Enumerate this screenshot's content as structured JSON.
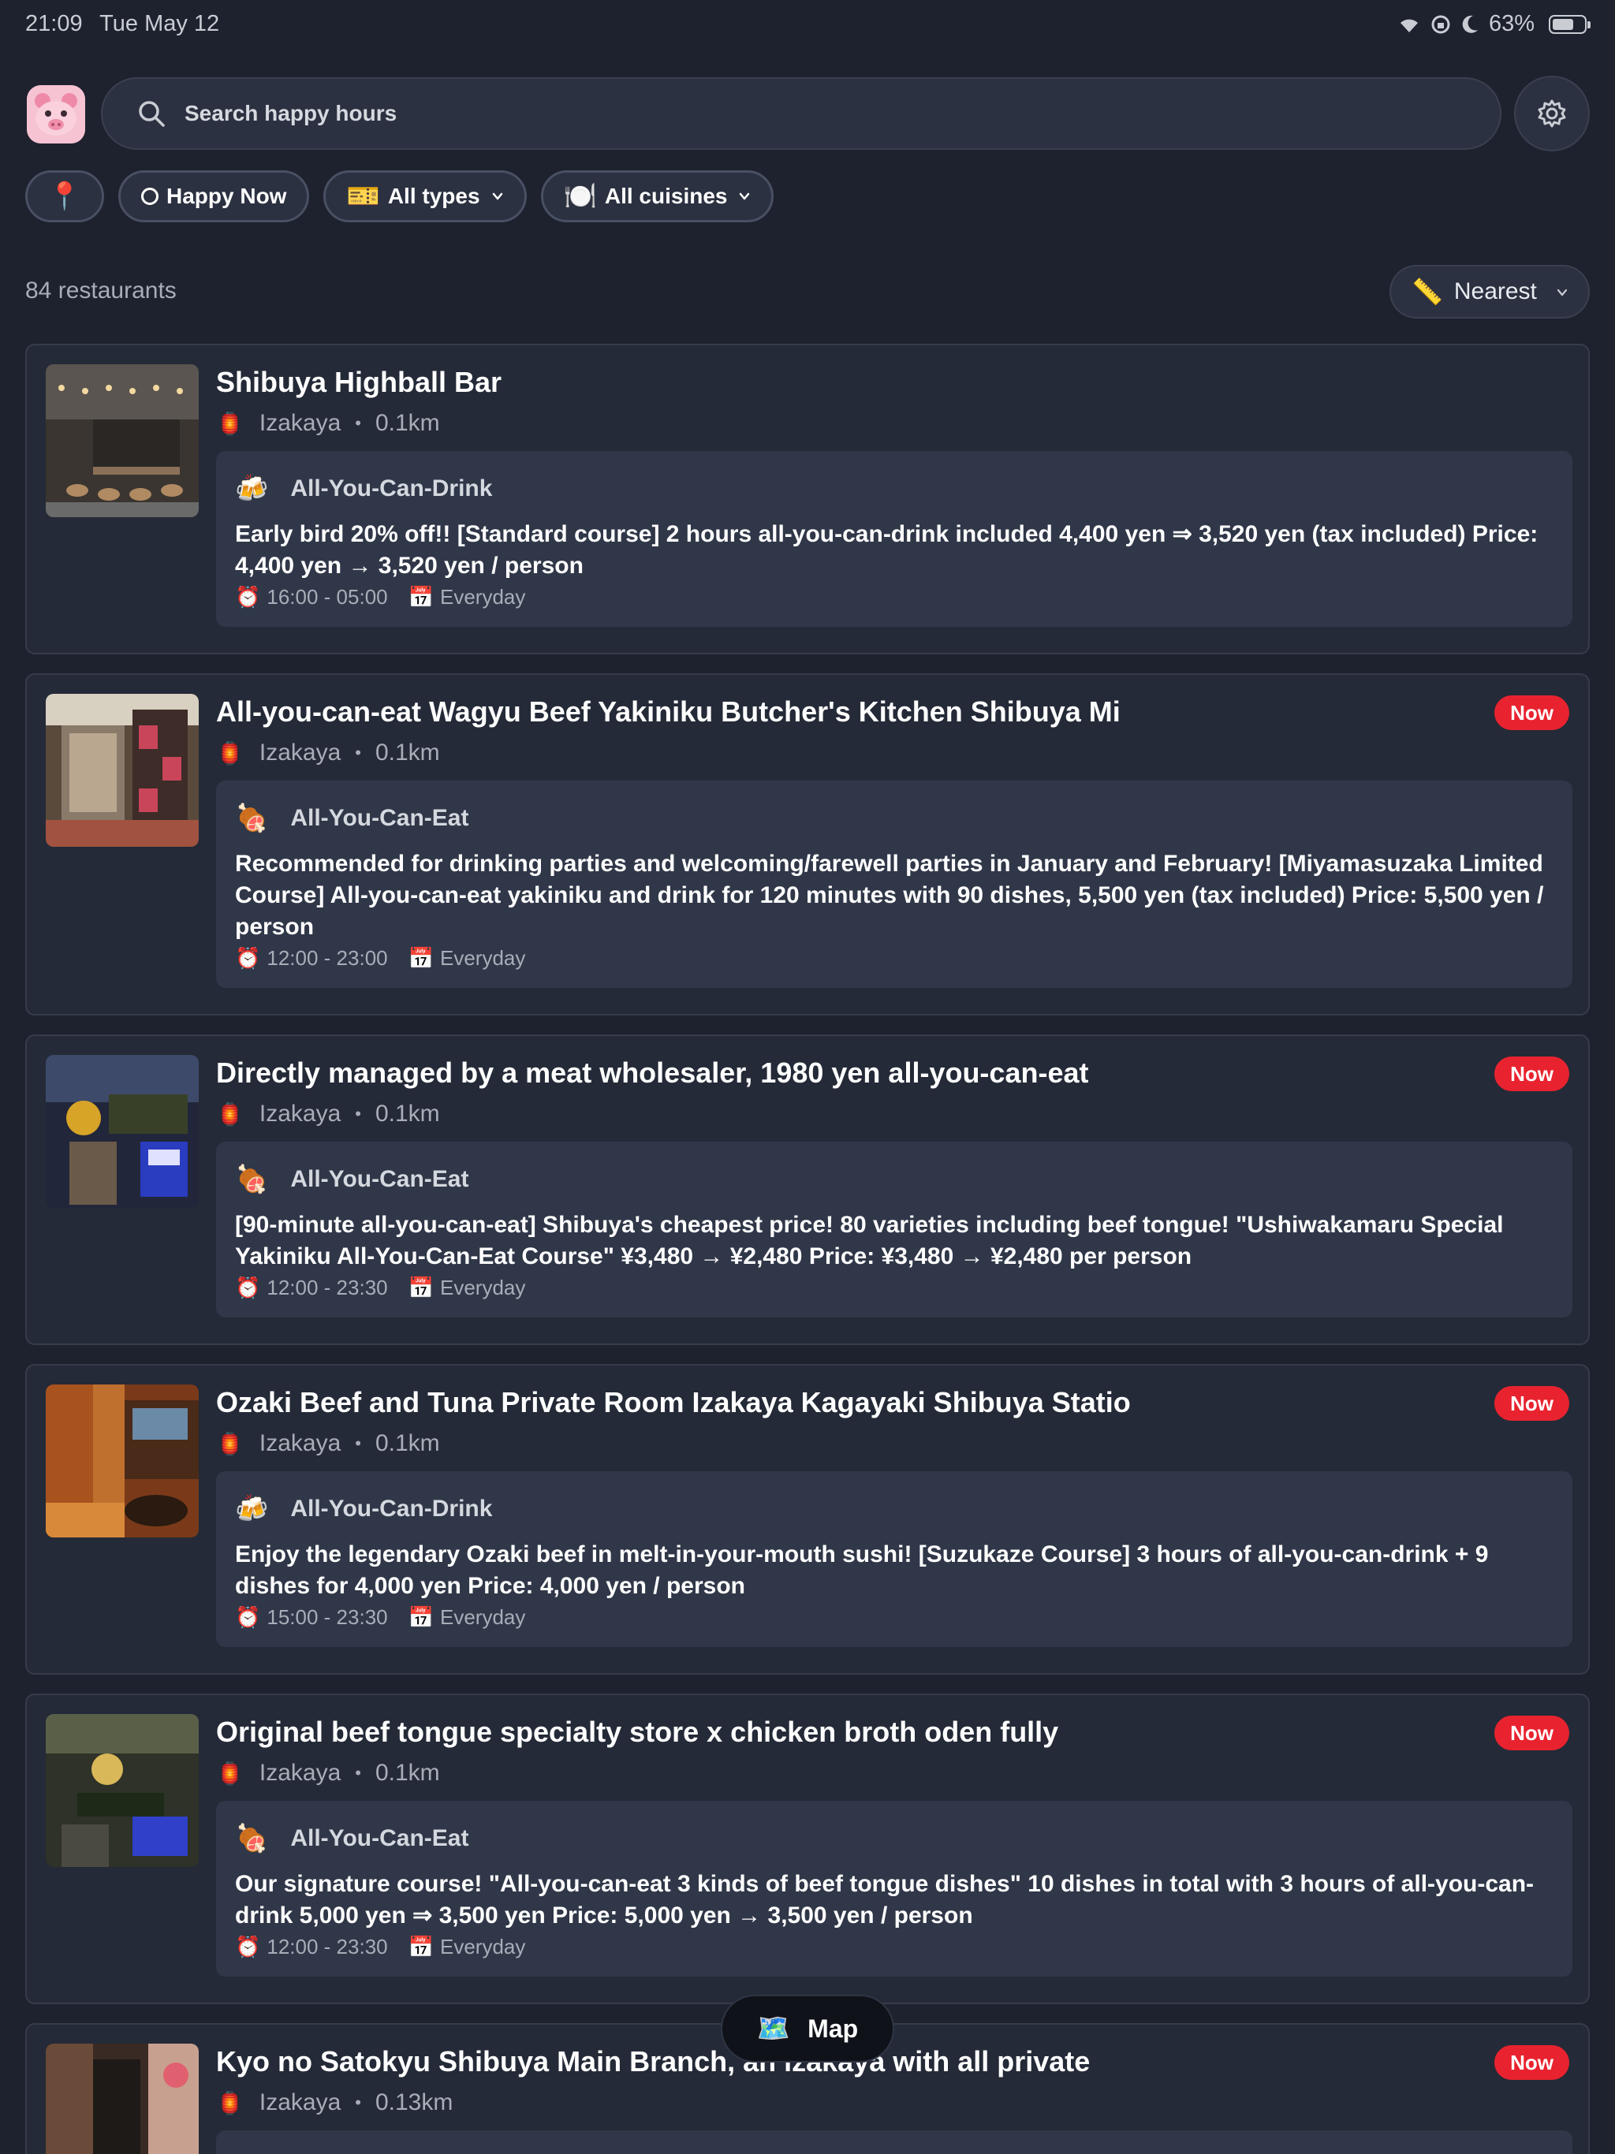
{
  "status": {
    "time": "21:09",
    "date": "Tue May 12",
    "battery": "63%"
  },
  "search": {
    "placeholder": "Search happy hours"
  },
  "filters": {
    "location_icon": "📍",
    "happy_now": "Happy Now",
    "types_icon": "🎫",
    "types": "All types",
    "cuisines_icon": "🍽️",
    "cuisines": "All cuisines"
  },
  "results": {
    "count": "84 restaurants"
  },
  "sort": {
    "icon": "📏",
    "label": "Nearest"
  },
  "cards": [
    {
      "title": "Shibuya Highball Bar",
      "now": "",
      "category_icon": "🏮",
      "category": "Izakaya",
      "distance": "0.1km",
      "deal_icon": "🍻",
      "deal_type": "All-You-Can-Drink",
      "description": "Early bird 20% off!! [Standard course] 2 hours all-you-can-drink included 4,400 yen ⇒ 3,520 yen (tax included) Price: 4,400 yen → 3,520 yen / person",
      "time_icon": "⏰",
      "hours": "16:00 - 05:00",
      "day_icon": "📅",
      "days": "Everyday"
    },
    {
      "title": "All-you-can-eat Wagyu Beef Yakiniku Butcher's Kitchen Shibuya Mi",
      "now": "Now",
      "category_icon": "🏮",
      "category": "Izakaya",
      "distance": "0.1km",
      "deal_icon": "🍖",
      "deal_type": "All-You-Can-Eat",
      "description": "Recommended for drinking parties and welcoming/farewell parties in January and February! [Miyamasuzaka Limited Course] All-you-can-eat yakiniku and drink for 120 minutes with 90 dishes, 5,500 yen (tax included) Price: 5,500 yen / person",
      "time_icon": "⏰",
      "hours": "12:00 - 23:00",
      "day_icon": "📅",
      "days": "Everyday"
    },
    {
      "title": "Directly managed by a meat wholesaler, 1980 yen all-you-can-eat",
      "now": "Now",
      "category_icon": "🏮",
      "category": "Izakaya",
      "distance": "0.1km",
      "deal_icon": "🍖",
      "deal_type": "All-You-Can-Eat",
      "description": "[90-minute all-you-can-eat] Shibuya's cheapest price! 80 varieties including beef tongue! \"Ushiwakamaru Special Yakiniku All-You-Can-Eat Course\" ¥3,480 → ¥2,480 Price: ¥3,480 → ¥2,480 per person",
      "time_icon": "⏰",
      "hours": "12:00 - 23:30",
      "day_icon": "📅",
      "days": "Everyday"
    },
    {
      "title": "Ozaki Beef and Tuna Private Room Izakaya Kagayaki Shibuya Statio",
      "now": "Now",
      "category_icon": "🏮",
      "category": "Izakaya",
      "distance": "0.1km",
      "deal_icon": "🍻",
      "deal_type": "All-You-Can-Drink",
      "description": "Enjoy the legendary Ozaki beef in melt-in-your-mouth sushi! [Suzukaze Course] 3 hours of all-you-can-drink + 9 dishes for 4,000 yen Price: 4,000 yen / person",
      "time_icon": "⏰",
      "hours": "15:00 - 23:30",
      "day_icon": "📅",
      "days": "Everyday"
    },
    {
      "title": "Original beef tongue specialty store x chicken broth oden fully",
      "now": "Now",
      "category_icon": "🏮",
      "category": "Izakaya",
      "distance": "0.1km",
      "deal_icon": "🍖",
      "deal_type": "All-You-Can-Eat",
      "description": "Our signature course! \"All-you-can-eat 3 kinds of beef tongue dishes\" 10 dishes in total with 3 hours of all-you-can-drink 5,000 yen ⇒ 3,500 yen Price: 5,000 yen → 3,500 yen / person",
      "time_icon": "⏰",
      "hours": "12:00 - 23:30",
      "day_icon": "📅",
      "days": "Everyday"
    },
    {
      "title": "Kyo no Satokyu Shibuya Main Branch, an izakaya with all private",
      "now": "Now",
      "category_icon": "🏮",
      "category": "Izakaya",
      "distance": "0.13km"
    }
  ],
  "map_button": {
    "icon": "🗺️",
    "label": "Map"
  },
  "colors": {
    "background": "#1d222e",
    "card": "#242a37",
    "deal_box": "#303748",
    "now_badge": "#e8232f"
  }
}
